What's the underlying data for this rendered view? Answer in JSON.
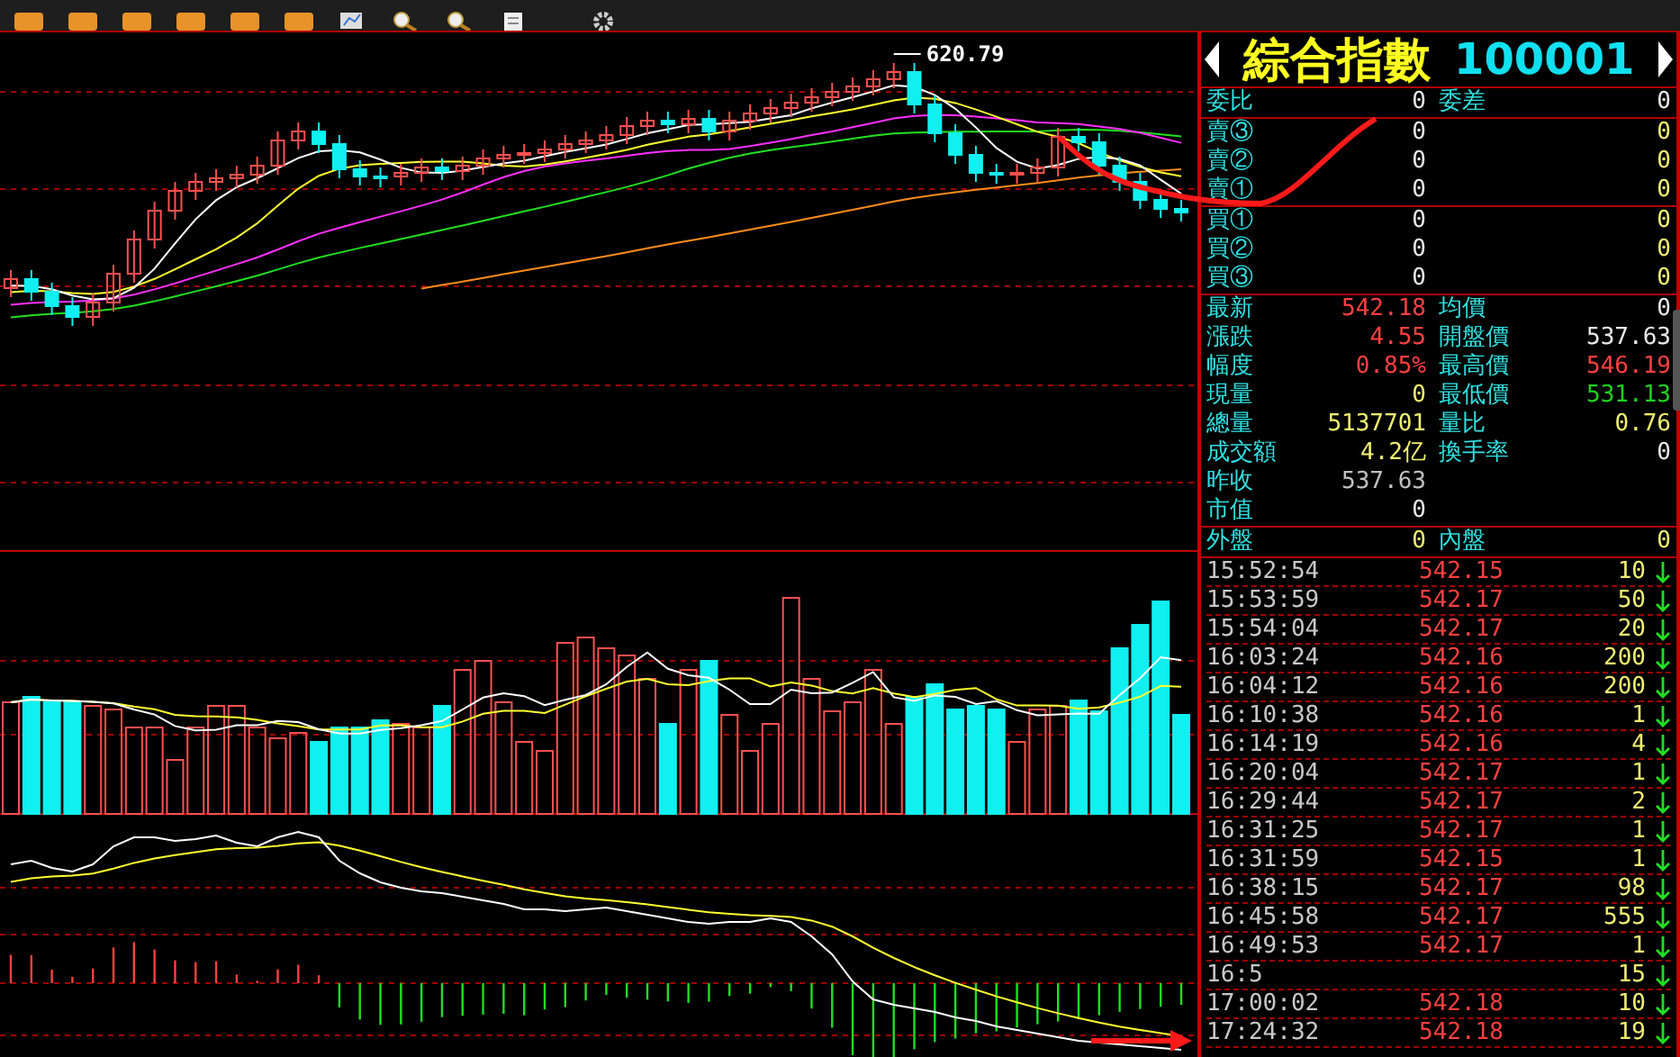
{
  "chart": {
    "peak_label": "620.79"
  },
  "quote": {
    "title": "綜合指數",
    "code": "100001",
    "ratio": {
      "label": "委比",
      "value": "0",
      "label2": "委差",
      "value2": "0"
    },
    "sell": [
      {
        "label": "賣③",
        "price": "0",
        "volume": "0"
      },
      {
        "label": "賣②",
        "price": "0",
        "volume": "0"
      },
      {
        "label": "賣①",
        "price": "0",
        "volume": "0"
      }
    ],
    "buy": [
      {
        "label": "買①",
        "price": "0",
        "volume": "0"
      },
      {
        "label": "買②",
        "price": "0",
        "volume": "0"
      },
      {
        "label": "買③",
        "price": "0",
        "volume": "0"
      }
    ],
    "stats": [
      {
        "cells": [
          {
            "label": "最新",
            "value": "542.18",
            "color": "#ff4040"
          },
          {
            "label": "均價",
            "value": "0",
            "color": "#e8e8e8"
          }
        ]
      },
      {
        "cells": [
          {
            "label": "漲跌",
            "value": "4.55",
            "color": "#ff4040"
          },
          {
            "label": "開盤價",
            "value": "537.63",
            "color": "#e8e8e8"
          }
        ]
      },
      {
        "cells": [
          {
            "label": "幅度",
            "value": "0.85%",
            "color": "#ff4040"
          },
          {
            "label": "最高價",
            "value": "546.19",
            "color": "#ff4040"
          }
        ]
      },
      {
        "cells": [
          {
            "label": "現量",
            "value": "0",
            "color": "#f0f070"
          },
          {
            "label": "最低價",
            "value": "531.13",
            "color": "#20d020"
          }
        ]
      },
      {
        "cells": [
          {
            "label": "總量",
            "value": "5137701",
            "color": "#f0f070"
          },
          {
            "label": "量比",
            "value": "0.76",
            "color": "#f0f070"
          }
        ]
      },
      {
        "cells": [
          {
            "label": "成交額",
            "value": "4.2亿",
            "color": "#f0f070"
          },
          {
            "label": "換手率",
            "value": "0",
            "color": "#e8e8e8"
          }
        ]
      },
      {
        "cells": [
          {
            "label": "昨收",
            "value": "537.63",
            "color": "#c0c0c0"
          }
        ]
      },
      {
        "cells": [
          {
            "label": "市值",
            "value": "0",
            "color": "#e8e8e8"
          }
        ]
      }
    ],
    "outer": {
      "label": "外盤",
      "value": "0",
      "label2": "內盤",
      "value2": "0"
    }
  },
  "ticks": [
    {
      "time": "15:52:54",
      "price": "542.15",
      "volume": "10",
      "rising": false
    },
    {
      "time": "15:53:59",
      "price": "542.17",
      "volume": "50",
      "rising": false
    },
    {
      "time": "15:54:04",
      "price": "542.17",
      "volume": "20",
      "rising": false
    },
    {
      "time": "16:03:24",
      "price": "542.16",
      "volume": "200",
      "rising": false
    },
    {
      "time": "16:04:12",
      "price": "542.16",
      "volume": "200",
      "rising": false
    },
    {
      "time": "16:10:38",
      "price": "542.16",
      "volume": "1",
      "rising": false
    },
    {
      "time": "16:14:19",
      "price": "542.16",
      "volume": "4",
      "rising": false
    },
    {
      "time": "16:20:04",
      "price": "542.17",
      "volume": "1",
      "rising": false
    },
    {
      "time": "16:29:44",
      "price": "542.17",
      "volume": "2",
      "rising": false
    },
    {
      "time": "16:31:25",
      "price": "542.17",
      "volume": "1",
      "rising": false
    },
    {
      "time": "16:31:59",
      "price": "542.15",
      "volume": "1",
      "rising": false
    },
    {
      "time": "16:38:15",
      "price": "542.17",
      "volume": "98",
      "rising": false
    },
    {
      "time": "16:45:58",
      "price": "542.17",
      "volume": "555",
      "rising": false
    },
    {
      "time": "16:49:53",
      "price": "542.17",
      "volume": "1",
      "rising": false
    },
    {
      "time": "16:5",
      "volume": "15",
      "rising": false
    },
    {
      "time": "17:00:02",
      "price": "542.18",
      "volume": "10",
      "rising": false
    },
    {
      "time": "17:24:32",
      "price": "542.18",
      "volume": "19",
      "rising": false
    }
  ]
}
